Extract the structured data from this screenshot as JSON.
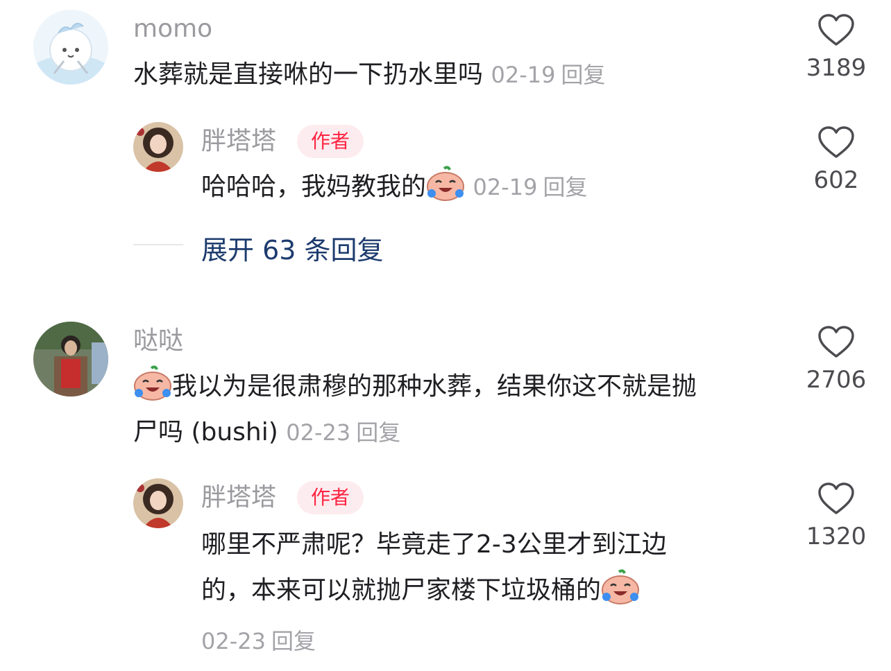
{
  "comments": [
    {
      "username": "momo",
      "text": "水葬就是直接咻的一下扔水里吗",
      "date": "02-19",
      "reply_label": "回复",
      "likes": "3189",
      "avatar_icon": "cartoon-bird-avatar",
      "reply": {
        "username": "胖塔塔",
        "badge": "作者",
        "text": "哈哈哈，我妈教我的",
        "emoji": "crying-laughing-emoji",
        "date": "02-19",
        "reply_label": "回复",
        "likes": "602",
        "avatar_icon": "portrait-avatar"
      },
      "expand_label": "展开 63 条回复"
    },
    {
      "username": "哒哒",
      "emoji": "crying-laughing-emoji",
      "text_line1": "我以为是很肃穆的那种水葬，结果你这不就是抛",
      "text_line2": "尸吗 (bushi)",
      "date": "02-23",
      "reply_label": "回复",
      "likes": "2706",
      "avatar_icon": "photo-avatar",
      "reply": {
        "username": "胖塔塔",
        "badge": "作者",
        "text_line1": "哪里不严肃呢？毕竟走了2-3公里才到江边",
        "text_line2": "的，本来可以就抛尸家楼下垃圾桶的",
        "emoji": "crying-laughing-emoji",
        "date": "02-23",
        "reply_label": "回复",
        "likes": "1320",
        "avatar_icon": "portrait-avatar"
      }
    }
  ]
}
